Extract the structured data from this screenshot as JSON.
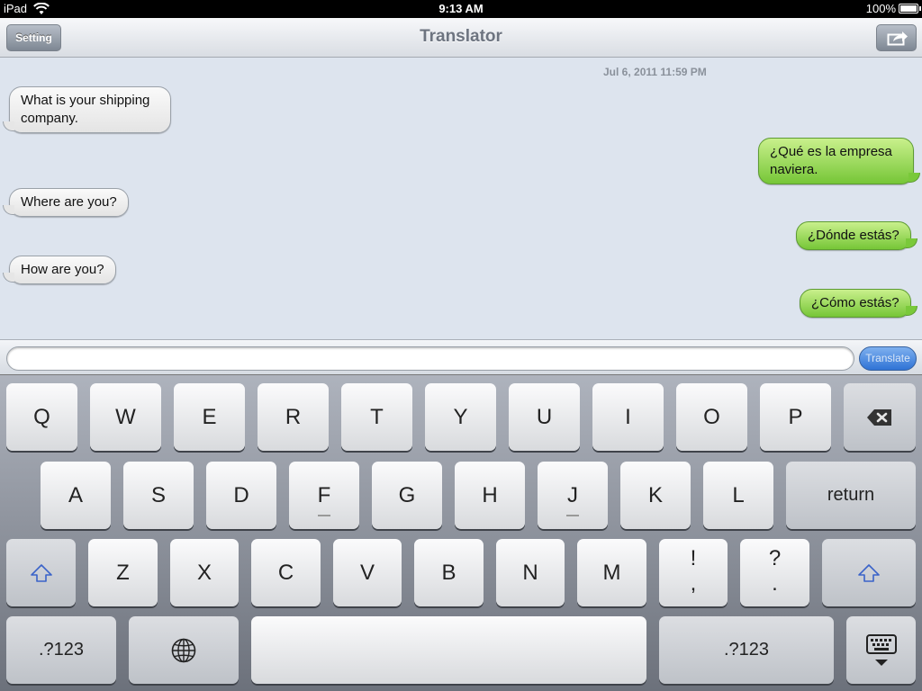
{
  "status_bar": {
    "carrier": "iPad",
    "time": "9:13 AM",
    "battery": "100%"
  },
  "navbar": {
    "title": "Translator",
    "setting_label": "Setting",
    "share_icon": "share-icon"
  },
  "chat": {
    "timestamp": "Jul 6, 2011 11:59 PM",
    "messages": [
      {
        "side": "in",
        "text": "What is your shipping company."
      },
      {
        "side": "out",
        "text": "¿Qué es la empresa naviera."
      },
      {
        "side": "in",
        "text": "Where are you?"
      },
      {
        "side": "out",
        "text": "¿Dónde estás?"
      },
      {
        "side": "in",
        "text": "How are you?"
      },
      {
        "side": "out",
        "text": "¿Cómo estás?"
      }
    ]
  },
  "input": {
    "value": "",
    "placeholder": "",
    "translate_label": "Translate"
  },
  "keyboard": {
    "row1": [
      "Q",
      "W",
      "E",
      "R",
      "T",
      "Y",
      "U",
      "I",
      "O",
      "P"
    ],
    "row2": [
      "A",
      "S",
      "D",
      "F",
      "G",
      "H",
      "J",
      "K",
      "L"
    ],
    "row3": [
      "Z",
      "X",
      "C",
      "V",
      "B",
      "N",
      "M"
    ],
    "punct1": {
      "top": "!",
      "bottom": ","
    },
    "punct2": {
      "top": "?",
      "bottom": "."
    },
    "return_label": "return",
    "numbers_label": ".?123",
    "numbers_label_right": ".?123",
    "icons": {
      "backspace": "backspace-icon",
      "shift": "shift-icon",
      "globe": "globe-icon",
      "hide": "hide-keyboard-icon"
    }
  }
}
